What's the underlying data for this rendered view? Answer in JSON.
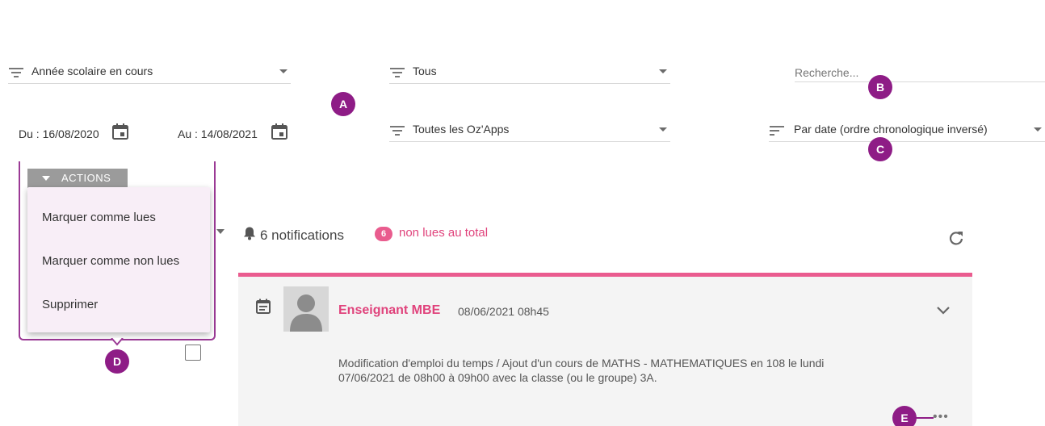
{
  "filters": {
    "school_year": "Année scolaire en cours",
    "type": "Tous",
    "search_placeholder": "Recherche...",
    "apps": "Toutes les Oz'Apps",
    "sort": "Par date (ordre chronologique inversé)"
  },
  "dates": {
    "from": "Du : 16/08/2020",
    "to": "Au : 14/08/2021"
  },
  "markers": {
    "a": "A",
    "b": "B",
    "c": "C",
    "d": "D",
    "e": "E"
  },
  "actions": {
    "button_label": "ACTIONS",
    "menu": [
      "Marquer comme lues",
      "Marquer comme non lues",
      "Supprimer"
    ]
  },
  "notifications": {
    "count_label": "6 notifications",
    "unread_count": "6",
    "unread_label": "non lues au total"
  },
  "card": {
    "author": "Enseignant MBE",
    "timestamp": "08/06/2021 08h45",
    "message_line1": "Modification d'emploi du temps / Ajout d'un cours de MATHS - MATHEMATIQUES en 108 le lundi",
    "message_line2": "07/06/2021 de 08h00 à 09h00 avec la classe (ou le groupe) 3A.",
    "more": "•••"
  },
  "colors": {
    "accent_pink": "#e0437c",
    "marker_purple": "#8e1c86",
    "card_bg": "#f4f4f4"
  },
  "icons": [
    "filter-icon",
    "sort-icon",
    "calendar-icon",
    "bell-icon",
    "refresh-icon",
    "chevron-down-icon",
    "avatar-icon",
    "more-icon"
  ]
}
